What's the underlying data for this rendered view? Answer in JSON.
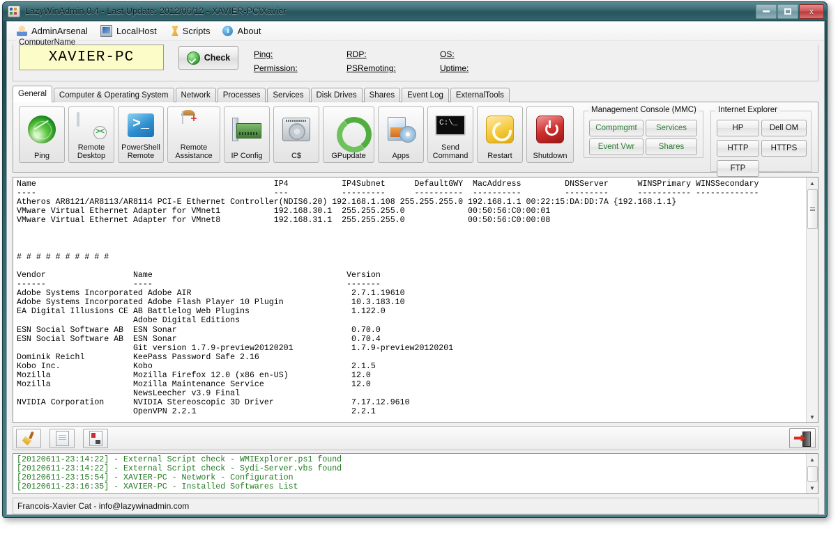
{
  "window": {
    "title": "LazyWinAdmin 0.4 - Last Update: 2012/06/12 - XAVIER-PC\\Xavier",
    "minimize_label": "Minimize",
    "maximize_label": "Maximize",
    "close_label": "x"
  },
  "menubar": [
    {
      "label": "AdminArsenal",
      "icon": "person-icon"
    },
    {
      "label": "LocalHost",
      "icon": "monitor-icon"
    },
    {
      "label": "Scripts",
      "icon": "script-icon"
    },
    {
      "label": "About",
      "icon": "info-icon"
    }
  ],
  "computer": {
    "group_label": "ComputerName",
    "name_value": "XAVIER-PC",
    "name_placeholder": "ComputerName",
    "check_label": "Check",
    "status": [
      {
        "label": "Ping:",
        "value": ""
      },
      {
        "label": "Permission:",
        "value": ""
      },
      {
        "label": "RDP:",
        "value": ""
      },
      {
        "label": "PSRemoting:",
        "value": ""
      },
      {
        "label": "OS:",
        "value": ""
      },
      {
        "label": "Uptime:",
        "value": ""
      }
    ]
  },
  "tabs": [
    {
      "label": "General",
      "active": true
    },
    {
      "label": "Computer & Operating System",
      "active": false
    },
    {
      "label": "Network",
      "active": false
    },
    {
      "label": "Processes",
      "active": false
    },
    {
      "label": "Services",
      "active": false
    },
    {
      "label": "Disk Drives",
      "active": false
    },
    {
      "label": "Shares",
      "active": false
    },
    {
      "label": "Event Log",
      "active": false
    },
    {
      "label": "ExternalTools",
      "active": false
    }
  ],
  "toolbar_buttons": [
    {
      "label": "Ping",
      "icon": "radar-icon"
    },
    {
      "label": "Remote\nDesktop",
      "line1": "Remote",
      "line2": "Desktop",
      "icon": "remote-desktop-icon"
    },
    {
      "label": "PowerShell\nRemote",
      "line1": "PowerShell",
      "line2": "Remote",
      "icon": "powershell-icon"
    },
    {
      "label": "Remote\nAssistance",
      "line1": "Remote",
      "line2": "Assistance",
      "icon": "remote-assistance-icon"
    },
    {
      "label": "IP Config",
      "line1": "IP Config",
      "line2": "",
      "icon": "network-card-icon"
    },
    {
      "label": "C$",
      "line1": "C$",
      "line2": "",
      "icon": "hard-drive-icon"
    },
    {
      "label": "GPupdate",
      "line1": "GPupdate",
      "line2": "",
      "icon": "refresh-icon"
    },
    {
      "label": "Apps",
      "line1": "Apps",
      "line2": "",
      "icon": "apps-icon"
    },
    {
      "label": "Send\nCommand",
      "line1": "Send",
      "line2": "Command",
      "icon": "console-icon"
    },
    {
      "label": "Restart",
      "line1": "Restart",
      "line2": "",
      "icon": "restart-icon"
    },
    {
      "label": "Shutdown",
      "line1": "Shutdown",
      "line2": "",
      "icon": "power-icon"
    }
  ],
  "mmc": {
    "caption": "Management Console (MMC)",
    "buttons": [
      "Compmgmt",
      "Services",
      "Event Vwr",
      "Shares"
    ],
    "text_color": "#2e7d32"
  },
  "ie": {
    "caption": "Internet Explorer",
    "buttons": [
      "HP",
      "Dell OM",
      "HTTP",
      "HTTPS",
      "FTP"
    ]
  },
  "output": {
    "text": "Name                                                 IP4           IP4Subnet      DefaultGWY  MacAddress         DNSServer      WINSPrimary WINSSecondary\n----                                                 ---           ---------      ----------  ----------         ---------      ----------- -------------\nAtheros AR8121/AR8113/AR8114 PCI-E Ethernet Controller(NDIS6.20) 192.168.1.108 255.255.255.0 192.168.1.1 00:22:15:DA:DD:7A {192.168.1.1}\nVMware Virtual Ethernet Adapter for VMnet1           192.168.30.1  255.255.255.0             00:50:56:C0:00:01\nVMware Virtual Ethernet Adapter for VMnet8           192.168.31.1  255.255.255.0             00:50:56:C0:00:08\n\n\n\n# # # # # # # # # #\n\nVendor                  Name                                        Version\n------                  ----                                        -------\nAdobe Systems Incorporated Adobe AIR                                 2.7.1.19610\nAdobe Systems Incorporated Adobe Flash Player 10 Plugin              10.3.183.10\nEA Digital Illusions CE AB Battlelog Web Plugins                     1.122.0\n                        Adobe Digital Editions\nESN Social Software AB  ESN Sonar                                    0.70.0\nESN Social Software AB  ESN Sonar                                    0.70.4\n                        Git version 1.7.9-preview20120201            1.7.9-preview20120201\nDominik Reichl          KeePass Password Safe 2.16\nKobo Inc.               Kobo                                         2.1.5\nMozilla                 Mozilla Firefox 12.0 (x86 en-US)             12.0\nMozilla                 Mozilla Maintenance Service                  12.0\n                        NewsLeecher v3.9 Final\nNVIDIA Corporation      NVIDIA Stereoscopic 3D Driver                7.17.12.9610\n                        OpenVPN 2.2.1                                2.2.1",
    "scroll_up": "▲",
    "scroll_down": "▼"
  },
  "bottom_toolbar": {
    "buttons": [
      {
        "name": "clear-button",
        "icon": "broom-icon"
      },
      {
        "name": "copy-button",
        "icon": "document-icon"
      },
      {
        "name": "export-button",
        "icon": "document-save-icon"
      }
    ],
    "exit": {
      "name": "exit-button",
      "icon": "exit-door-icon"
    }
  },
  "log": {
    "lines": [
      "[20120611-23:14:22] - External Script check - WMIExplorer.ps1 found",
      "[20120611-23:14:22] - External Script check - Sydi-Server.vbs found",
      "[20120611-23:15:54] - XAVIER-PC - Network - Configuration",
      "[20120611-23:16:35] - XAVIER-PC - Installed Softwares List"
    ],
    "text_color": "#1f7a1f"
  },
  "statusbar": {
    "text": "Francois-Xavier Cat - info@lazywinadmin.com"
  }
}
